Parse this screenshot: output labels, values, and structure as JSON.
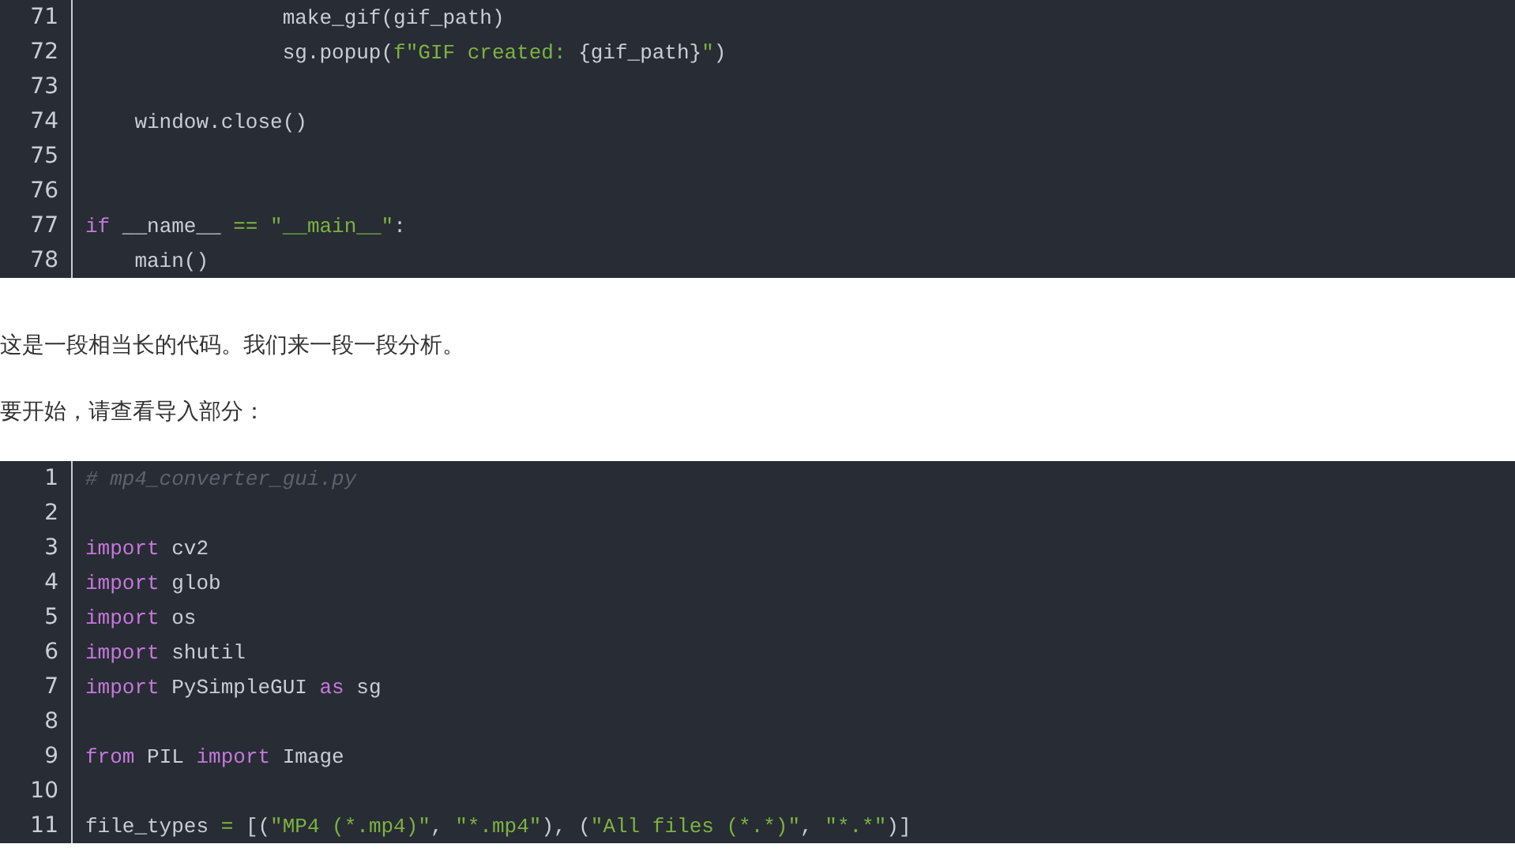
{
  "code_blocks": [
    {
      "lines": [
        {
          "number": "71",
          "tokens": [
            {
              "kind": "plain",
              "text": "                make_gif(gif_path)"
            }
          ]
        },
        {
          "number": "72",
          "tokens": [
            {
              "kind": "plain",
              "text": "                sg.popup("
            },
            {
              "kind": "string",
              "text": "f\"GIF created: "
            },
            {
              "kind": "plain",
              "text": "{gif_path}"
            },
            {
              "kind": "string",
              "text": "\""
            },
            {
              "kind": "plain",
              "text": ")"
            }
          ]
        },
        {
          "number": "73"
        },
        {
          "number": "74",
          "tokens": [
            {
              "kind": "plain",
              "text": "    window.close()"
            }
          ]
        },
        {
          "number": "75"
        },
        {
          "number": "76"
        },
        {
          "number": "77",
          "tokens": [
            {
              "kind": "keyword",
              "text": "if"
            },
            {
              "kind": "plain",
              "text": " __name__ "
            },
            {
              "kind": "operator",
              "text": "=="
            },
            {
              "kind": "string",
              "text": " \"__main__\""
            },
            {
              "kind": "plain",
              "text": ":"
            }
          ]
        },
        {
          "number": "78",
          "tokens": [
            {
              "kind": "plain",
              "text": "    main()"
            }
          ]
        }
      ]
    },
    {
      "lines": [
        {
          "number": "1",
          "tokens": [
            {
              "kind": "comment",
              "text": "# mp4_converter_gui.py"
            }
          ]
        },
        {
          "number": "2"
        },
        {
          "number": "3",
          "tokens": [
            {
              "kind": "keyword",
              "text": "import"
            },
            {
              "kind": "plain",
              "text": " cv2"
            }
          ]
        },
        {
          "number": "4",
          "tokens": [
            {
              "kind": "keyword",
              "text": "import"
            },
            {
              "kind": "plain",
              "text": " glob"
            }
          ]
        },
        {
          "number": "5",
          "tokens": [
            {
              "kind": "keyword",
              "text": "import"
            },
            {
              "kind": "plain",
              "text": " os"
            }
          ]
        },
        {
          "number": "6",
          "tokens": [
            {
              "kind": "keyword",
              "text": "import"
            },
            {
              "kind": "plain",
              "text": " shutil"
            }
          ]
        },
        {
          "number": "7",
          "tokens": [
            {
              "kind": "keyword",
              "text": "import"
            },
            {
              "kind": "plain",
              "text": " PySimpleGUI "
            },
            {
              "kind": "keyword",
              "text": "as"
            },
            {
              "kind": "plain",
              "text": " sg"
            }
          ]
        },
        {
          "number": "8"
        },
        {
          "number": "9",
          "tokens": [
            {
              "kind": "keyword",
              "text": "from"
            },
            {
              "kind": "plain",
              "text": " PIL "
            },
            {
              "kind": "keyword",
              "text": "import"
            },
            {
              "kind": "plain",
              "text": " Image"
            }
          ]
        },
        {
          "number": "10"
        },
        {
          "number": "11",
          "tokens": [
            {
              "kind": "plain",
              "text": "file_types "
            },
            {
              "kind": "operator",
              "text": "="
            },
            {
              "kind": "plain",
              "text": " [("
            },
            {
              "kind": "string",
              "text": "\"MP4 (*.mp4)\""
            },
            {
              "kind": "plain",
              "text": ", "
            },
            {
              "kind": "string",
              "text": "\"*.mp4\""
            },
            {
              "kind": "plain",
              "text": "), ("
            },
            {
              "kind": "string",
              "text": "\"All files (*.*)\""
            },
            {
              "kind": "plain",
              "text": ", "
            },
            {
              "kind": "string",
              "text": "\"*.*\""
            },
            {
              "kind": "plain",
              "text": ")]"
            }
          ]
        }
      ]
    }
  ],
  "paragraphs": [
    "这是一段相当长的代码。我们来一段一段分析。",
    "要开始，请查看导入部分："
  ]
}
